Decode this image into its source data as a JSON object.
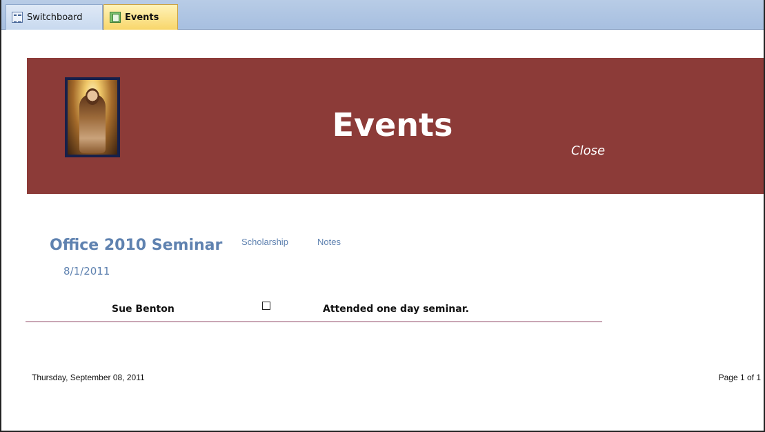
{
  "tabs": [
    {
      "label": "Switchboard",
      "icon": "switchboard-icon",
      "active": false
    },
    {
      "label": "Events",
      "icon": "report-icon",
      "active": true
    }
  ],
  "report": {
    "title": "Events",
    "close_label": "Close",
    "header_color": "#8c3b38"
  },
  "group": {
    "event_name": "Office 2010 Seminar",
    "event_date": "8/1/2011",
    "scholarship_header": "Scholarship",
    "notes_header": "Notes"
  },
  "rows": [
    {
      "name": "Sue  Benton",
      "scholarship": false,
      "notes": "Attended one day seminar."
    }
  ],
  "footer": {
    "date": "Thursday, September 08, 2011",
    "page": "Page 1 of 1"
  }
}
